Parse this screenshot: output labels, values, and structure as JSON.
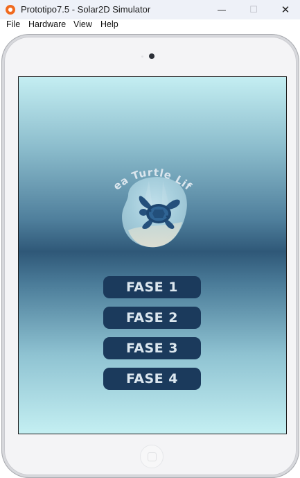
{
  "window": {
    "title": "Prototipo7.5 - Solar2D Simulator",
    "minimize_symbol": "—",
    "maximize_symbol": "☐",
    "close_symbol": "✕"
  },
  "menu": {
    "items": [
      "File",
      "Hardware",
      "View",
      "Help"
    ]
  },
  "game": {
    "logo_text": "Sea Turtle Life",
    "buttons": [
      "FASE 1",
      "FASE 2",
      "FASE 3",
      "FASE 4"
    ]
  },
  "colors": {
    "button_bg": "#1b3a5c",
    "button_text": "#dce7ef",
    "app_icon": "#f06a1f"
  }
}
